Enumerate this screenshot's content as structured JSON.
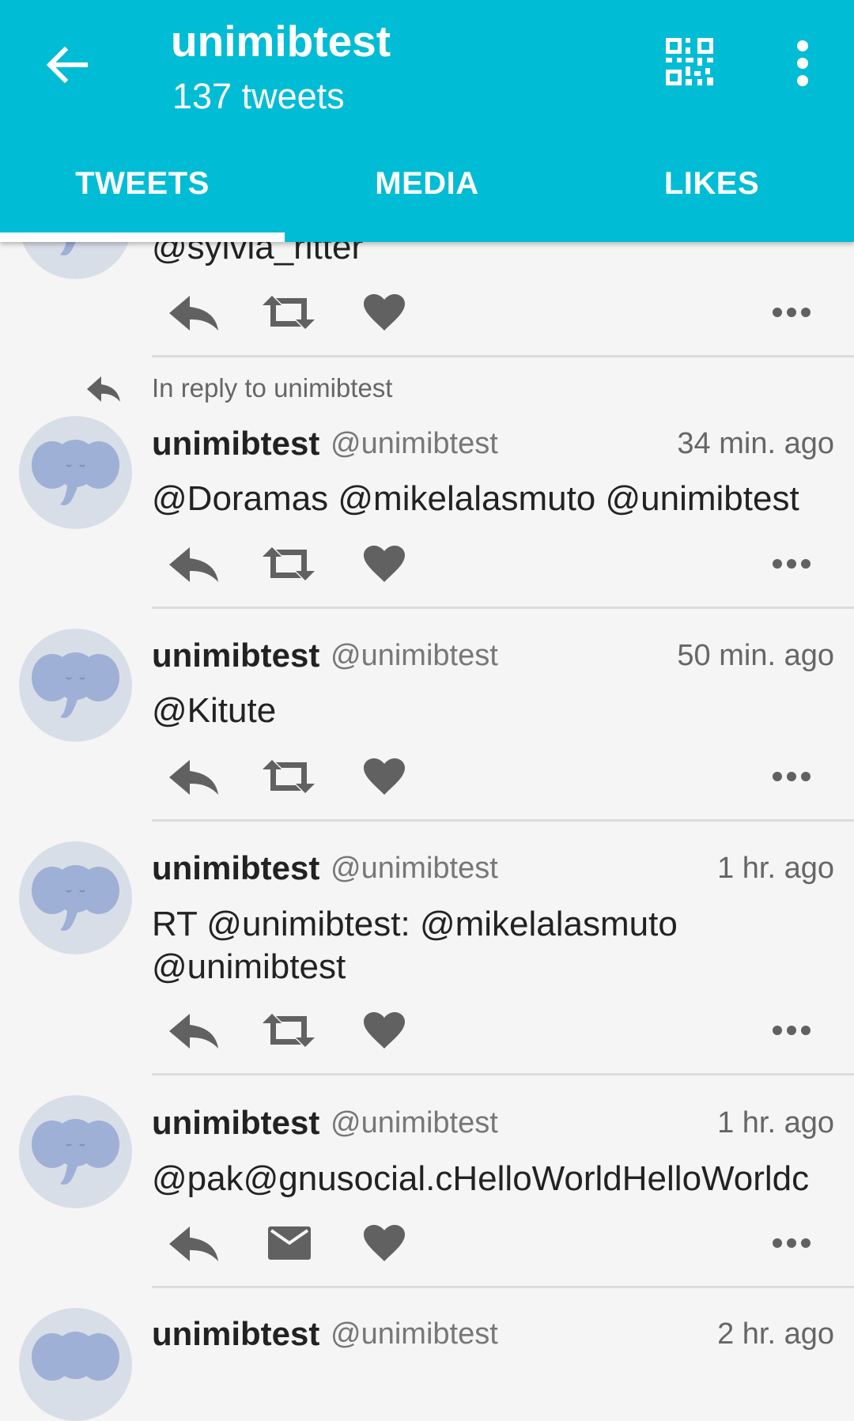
{
  "header": {
    "title": "unimibtest",
    "subtitle": "137 tweets",
    "accent_color": "#00bcd4",
    "back_icon": "arrow-left-icon",
    "qr_icon": "qr-code-icon",
    "more_icon": "more-vertical-icon"
  },
  "tabs": [
    {
      "label": "TWEETS",
      "selected": true
    },
    {
      "label": "MEDIA",
      "selected": false
    },
    {
      "label": "LIKES",
      "selected": false
    }
  ],
  "partial_tweet": {
    "text": "@sylvia_ritter"
  },
  "tweets": [
    {
      "reply_hint": "In reply to unimibtest",
      "name": "unimibtest",
      "handle": "@unimibtest",
      "time": "34 min. ago",
      "text": "@Doramas @mikelalasmuto @unimibtest",
      "second_action": "retweet-icon"
    },
    {
      "name": "unimibtest",
      "handle": "@unimibtest",
      "time": "50 min. ago",
      "text": "@Kitute",
      "second_action": "retweet-icon"
    },
    {
      "name": "unimibtest",
      "handle": "@unimibtest",
      "time": "1 hr. ago",
      "text": "RT @unimibtest: @mikelalasmuto @unimibtest",
      "second_action": "retweet-icon"
    },
    {
      "name": "unimibtest",
      "handle": "@unimibtest",
      "time": "1 hr. ago",
      "text": "@pak@gnusocial.cHelloWorldHelloWorldc",
      "second_action": "direct-message-icon"
    },
    {
      "name": "unimibtest",
      "handle": "@unimibtest",
      "time": "2 hr. ago"
    }
  ]
}
